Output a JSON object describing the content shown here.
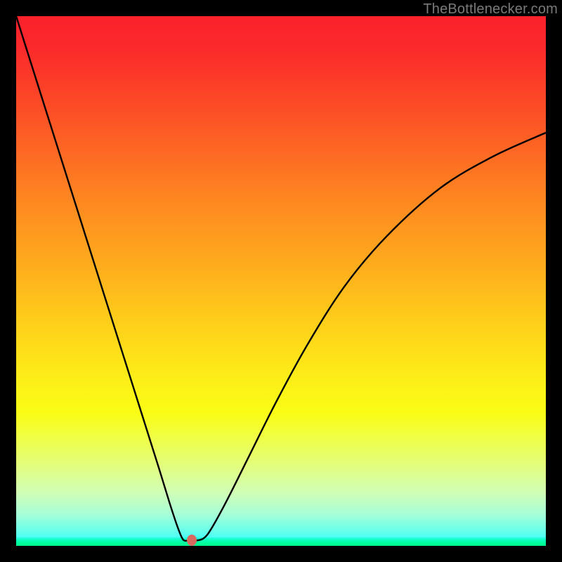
{
  "watermark": "TheBottlenecker.com",
  "colors": {
    "frame": "#000000",
    "curve": "#000000",
    "dot": "#d86a5f",
    "gradient_top": "#fb212b",
    "gradient_bottom": "#00ff87"
  },
  "chart_data": {
    "type": "line",
    "title": "",
    "xlabel": "",
    "ylabel": "",
    "xlim": [
      0,
      100
    ],
    "ylim": [
      0,
      100
    ],
    "series": [
      {
        "name": "bottleneck-curve",
        "x": [
          0,
          3,
          6,
          9,
          12,
          15,
          18,
          21,
          24,
          27,
          29,
          30.5,
          31.5,
          32.5,
          34,
          35.5,
          37,
          40,
          44,
          49,
          55,
          62,
          70,
          80,
          90,
          100
        ],
        "y": [
          100,
          90.5,
          81,
          71.5,
          62,
          52.5,
          43,
          33.5,
          24,
          14.5,
          8,
          3.5,
          1.2,
          1.0,
          1.0,
          1.5,
          3.5,
          9,
          17,
          27,
          38,
          49,
          58.5,
          67.5,
          73.5,
          78
        ]
      }
    ],
    "annotations": [
      {
        "name": "minimum-dot",
        "x": 33.2,
        "y": 1.0
      }
    ],
    "background": {
      "type": "vertical-gradient",
      "description": "red (top) through orange/yellow to green (bottom)"
    }
  }
}
